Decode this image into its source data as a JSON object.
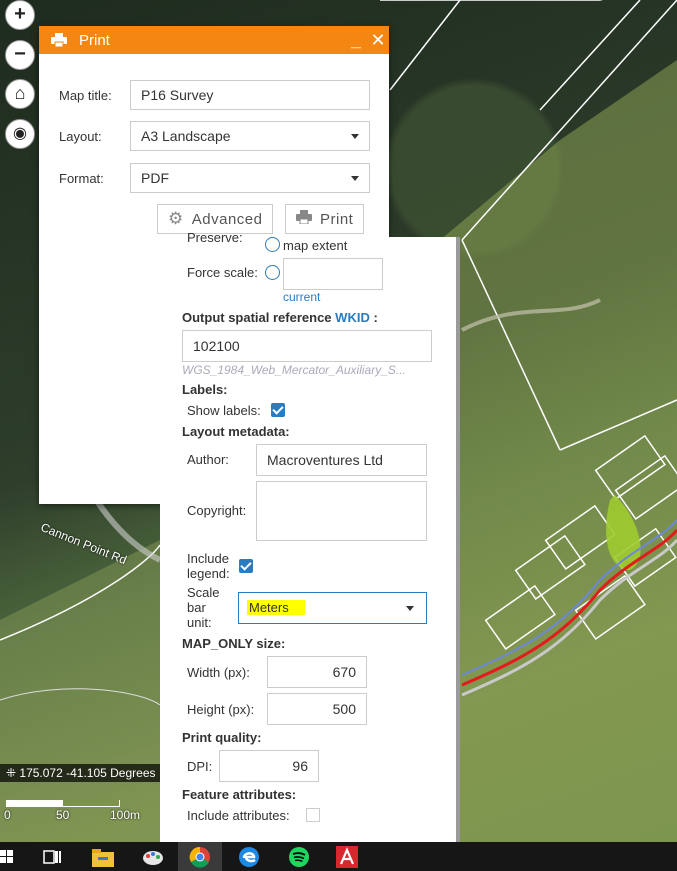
{
  "map": {
    "road_label": "Cannon Point Rd",
    "coordinates": "175.072 -41.105 Degrees",
    "scale_ticks": [
      "0",
      "50",
      "100m"
    ],
    "controls": [
      {
        "name": "zoom-in",
        "glyph": "+"
      },
      {
        "name": "zoom-out",
        "glyph": "−"
      },
      {
        "name": "home",
        "glyph": "⌂"
      },
      {
        "name": "locate",
        "glyph": "◉"
      }
    ]
  },
  "dialog": {
    "title": "Print",
    "minimize": "_",
    "close": "✕",
    "map_title_label": "Map title:",
    "map_title_value": "P16 Survey",
    "layout_label": "Layout:",
    "layout_value": "A3 Landscape",
    "format_label": "Format:",
    "format_value": "PDF",
    "advanced_label": "Advanced",
    "print_label": "Print",
    "accent_color": "#f58611"
  },
  "advanced": {
    "preserve_label": "Preserve:",
    "map_extent_label": "map extent",
    "force_scale_label": "Force scale:",
    "force_scale_value": "",
    "current_link": "current",
    "osr_label": "Output spatial reference",
    "wkid_link": "WKID",
    "osr_colon": ":",
    "wkid_value": "102100",
    "wkid_desc": "WGS_1984_Web_Mercator_Auxiliary_S...",
    "labels_heading": "Labels:",
    "show_labels_label": "Show labels:",
    "show_labels_checked": true,
    "layout_metadata_heading": "Layout metadata:",
    "author_label": "Author:",
    "author_value": "Macroventures Ltd",
    "copyright_label": "Copyright:",
    "copyright_value": "",
    "include_legend_label": [
      "Include",
      "legend:"
    ],
    "include_legend_checked": true,
    "scale_bar_unit_label": [
      "Scale",
      "bar",
      "unit:"
    ],
    "scale_bar_unit_value": "Meters",
    "map_only_heading": "MAP_ONLY size:",
    "width_label": "Width (px):",
    "width_value": "670",
    "height_label": "Height (px):",
    "height_value": "500",
    "print_quality_heading": "Print quality:",
    "dpi_label": "DPI:",
    "dpi_value": "96",
    "feature_attributes_heading": "Feature attributes:",
    "include_attributes_label": "Include attributes:",
    "include_attributes_checked": false,
    "link_color": "#2a7cc1",
    "highlight_color": "#ffff00"
  },
  "taskbar": {
    "icons": [
      "windows-start-icon",
      "task-view-icon",
      "file-explorer-icon",
      "paint-app-icon",
      "chrome-icon",
      "edge-icon",
      "spotify-icon",
      "acrobat-icon"
    ]
  }
}
